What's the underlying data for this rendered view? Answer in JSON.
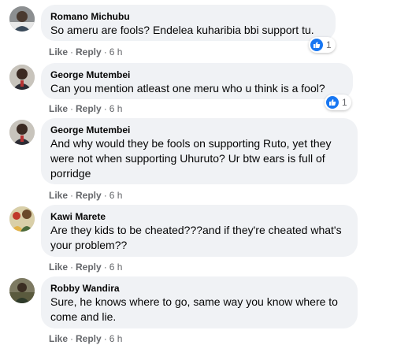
{
  "comments": [
    {
      "author": "Romano Michubu",
      "text": "So ameru are fools? Endelea kuharibia bbi support tu.",
      "actions": {
        "like": "Like",
        "reply": "Reply",
        "time": "6 h"
      },
      "reactions": {
        "icon": "like-icon",
        "count": "1"
      }
    },
    {
      "author": "George Mutembei",
      "text": "Can you mention atleast one meru who u think is a fool?",
      "actions": {
        "like": "Like",
        "reply": "Reply",
        "time": "6 h"
      },
      "reactions": {
        "icon": "like-icon",
        "count": "1"
      }
    },
    {
      "author": "George Mutembei",
      "text": "And why would they be fools on supporting Ruto, yet they were not when supporting Uhuruto? Ur btw ears is full of porridge",
      "actions": {
        "like": "Like",
        "reply": "Reply",
        "time": "6 h"
      }
    },
    {
      "author": "Kawi Marete",
      "text": "Are they kids to be cheated???and if they're cheated what's your problem??",
      "actions": {
        "like": "Like",
        "reply": "Reply",
        "time": "6 h"
      }
    },
    {
      "author": "Robby Wandira",
      "text": "Sure, he knows where to go, same way you know where to come and lie.",
      "actions": {
        "like": "Like",
        "reply": "Reply",
        "time": "6 h"
      }
    }
  ],
  "colors": {
    "bubble": "#f0f2f5",
    "meta_text": "#65676b",
    "like_blue": "#1877f2"
  }
}
